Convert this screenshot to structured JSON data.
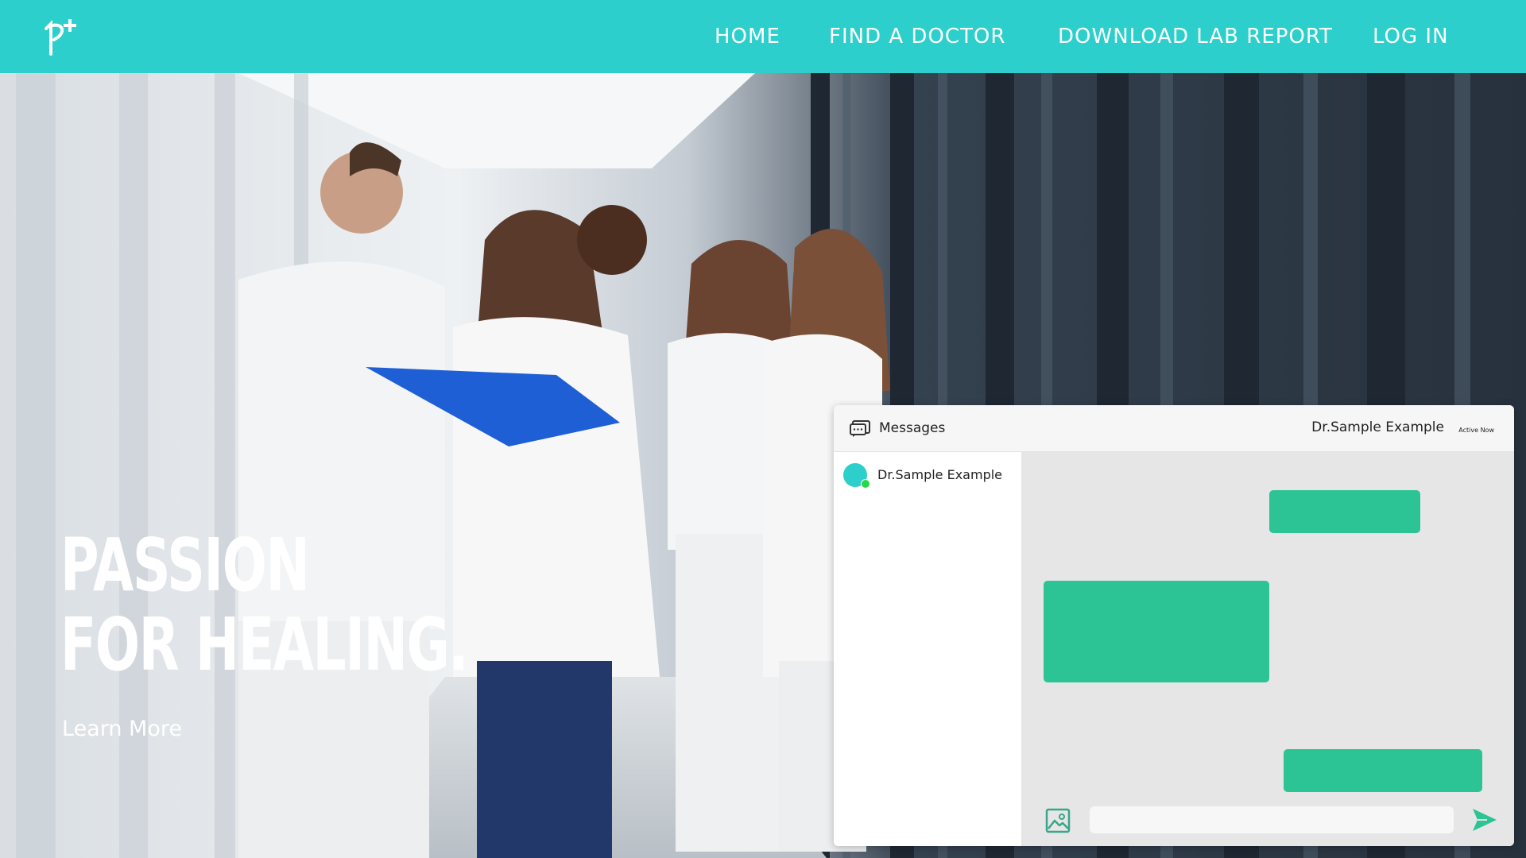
{
  "brand": {
    "logo_icon": "plus-cross-logo-icon",
    "primary_color": "#2ccfcb",
    "accent_color": "#2cc495"
  },
  "nav": {
    "items": [
      {
        "label": "HOME"
      },
      {
        "label": "FIND A DOCTOR"
      },
      {
        "label": "DOWNLOAD LAB REPORT"
      },
      {
        "label": "LOG IN"
      }
    ]
  },
  "hero": {
    "headline_line1": "PASSION",
    "headline_line2": "FOR HEALING.",
    "cta_label": "Learn More"
  },
  "chat": {
    "header_icon": "chat-bubble-icon",
    "title": "Messages",
    "active_contact": "Dr.Sample Example",
    "active_status": "Active Now",
    "contacts": [
      {
        "name": "Dr.Sample Example",
        "online": true
      }
    ],
    "input_placeholder": "",
    "attach_icon": "image-icon",
    "send_icon": "send-arrow-icon"
  }
}
